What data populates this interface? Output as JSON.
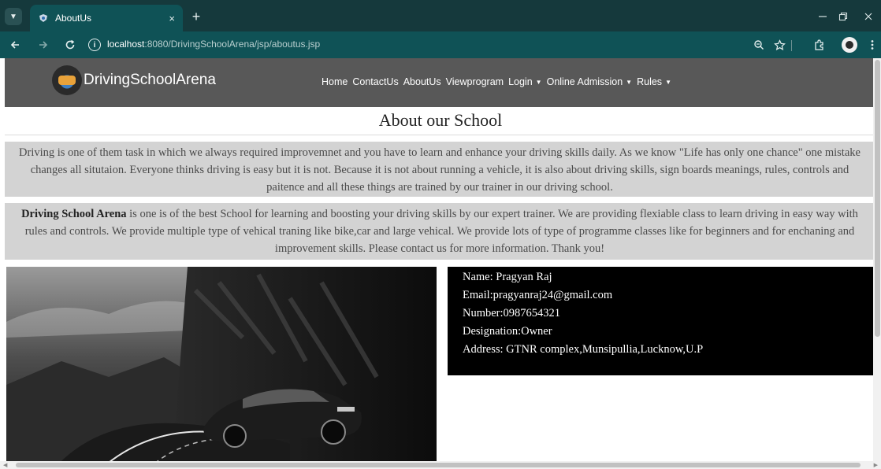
{
  "browser": {
    "tab_title": "AboutUs",
    "tab_close": "×",
    "new_tab": "+",
    "url_host": "localhost",
    "url_path": ":8080/DrivingSchoolArena/jsp/aboutus.jsp",
    "info_glyph": "i",
    "accent_color": "#0f5256",
    "icons": [
      "tab-search-icon",
      "shield-favicon-icon",
      "back-arrow-icon",
      "forward-arrow-icon",
      "reload-icon",
      "info-icon",
      "zoom-icon",
      "bookmark-star-icon",
      "extensions-icon",
      "profile-avatar",
      "more-menu-icon",
      "minimize-icon",
      "restore-icon",
      "close-window-icon"
    ]
  },
  "site": {
    "brand": "DrivingSchoolArena",
    "nav_bg": "#585858",
    "menu": [
      {
        "label": "Home"
      },
      {
        "label": "ContactUs"
      },
      {
        "label": "AboutUs"
      },
      {
        "label": "Viewprogram"
      },
      {
        "label": "Login",
        "dropdown": true
      },
      {
        "label": "Online Admission",
        "dropdown": true
      },
      {
        "label": "Rules",
        "dropdown": true
      }
    ]
  },
  "main": {
    "title": "About our School",
    "para1": "Driving is one of them task in which we always required improvemnet and you have to learn and enhance your driving skills daily. As we know \"Life has only one chance\" one mistake changes all situtaion. Everyone thinks driving is easy but it is not. Because it is not about running a vehicle, it is also about driving skills, sign boards meanings, rules, controls and paitence and all these things are trained by our trainer in our driving school.",
    "para2_bold": "Driving School Arena",
    "para2": " is one is of the best School for learning and boosting your driving skills by our expert trainer. We are providing flexiable class to learn driving in easy way with rules and controls. We provide multiple type of vehical traning like bike,car and large vehical. We provide lots of type of programme classes like for beginners and for enchaning and improvement skills. Please contact us for more information. Thank you!",
    "para_bg": "#d3d3d3"
  },
  "owner": {
    "name": "Name: Pragyan Raj",
    "email": "Email:pragyanraj24@gmail.com",
    "number": "Number:0987654321",
    "designation": "Designation:Owner",
    "address": "Address: GTNR complex,Munsipullia,Lucknow,U.P"
  }
}
